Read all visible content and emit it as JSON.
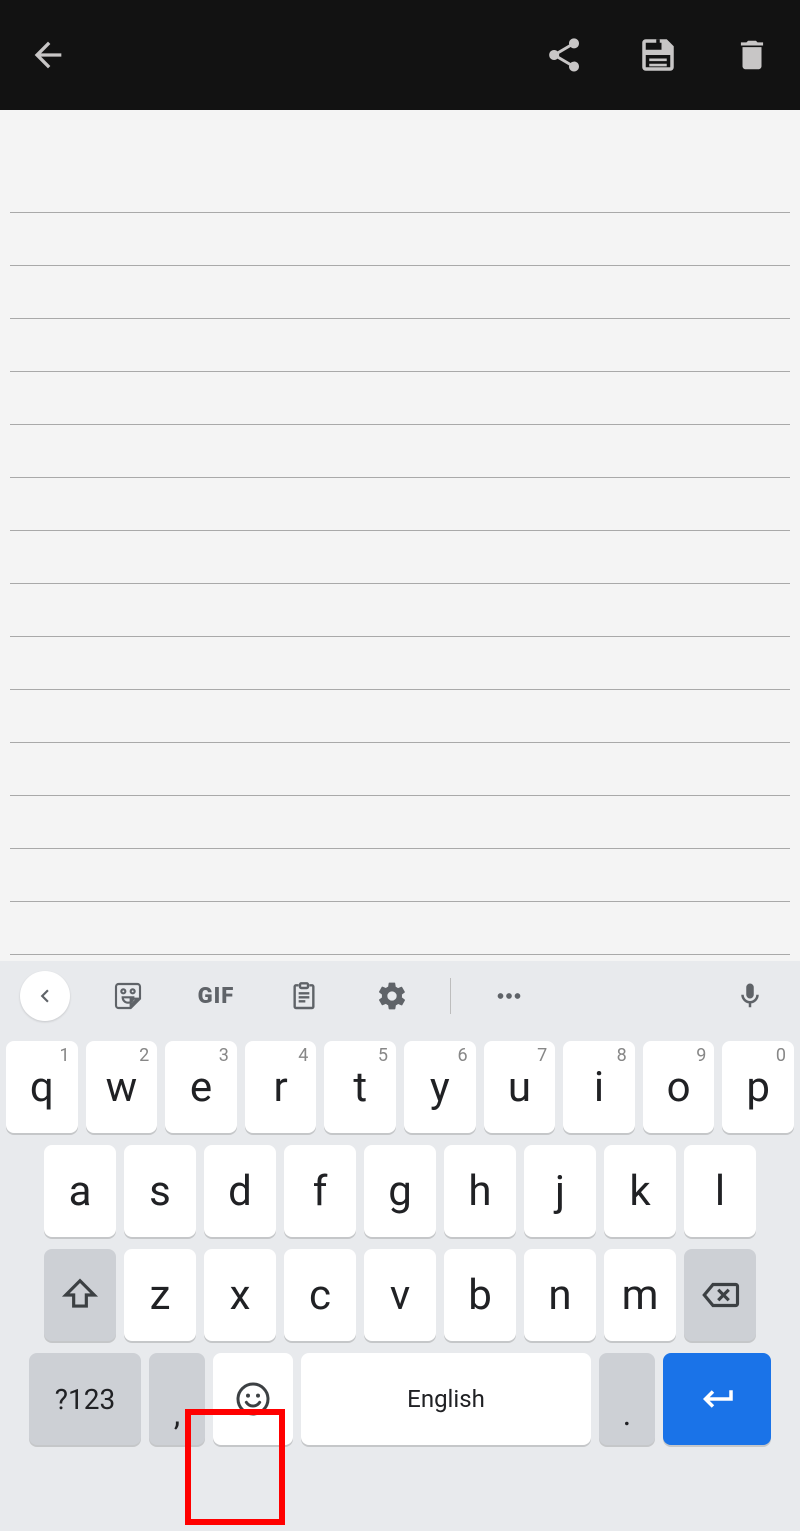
{
  "appbar": {
    "back_icon": "back-arrow-icon",
    "share_icon": "share-icon",
    "save_icon": "save-icon",
    "trash_icon": "trash-icon"
  },
  "note": {
    "line_count": 15,
    "content": ""
  },
  "keyboard": {
    "suggestion_bar": {
      "collapse_icon": "chevron-left-icon",
      "sticker_icon": "sticker-icon",
      "gif_label": "GIF",
      "clipboard_icon": "clipboard-icon",
      "settings_icon": "gear-icon",
      "more_icon": "more-horiz-icon",
      "voice_icon": "mic-icon"
    },
    "row1": [
      {
        "k": "q",
        "h": "1"
      },
      {
        "k": "w",
        "h": "2"
      },
      {
        "k": "e",
        "h": "3"
      },
      {
        "k": "r",
        "h": "4"
      },
      {
        "k": "t",
        "h": "5"
      },
      {
        "k": "y",
        "h": "6"
      },
      {
        "k": "u",
        "h": "7"
      },
      {
        "k": "i",
        "h": "8"
      },
      {
        "k": "o",
        "h": "9"
      },
      {
        "k": "p",
        "h": "0"
      }
    ],
    "row2": [
      {
        "k": "a"
      },
      {
        "k": "s"
      },
      {
        "k": "d"
      },
      {
        "k": "f"
      },
      {
        "k": "g"
      },
      {
        "k": "h"
      },
      {
        "k": "j"
      },
      {
        "k": "k"
      },
      {
        "k": "l"
      }
    ],
    "row3": [
      {
        "k": "z"
      },
      {
        "k": "x"
      },
      {
        "k": "c"
      },
      {
        "k": "v"
      },
      {
        "k": "b"
      },
      {
        "k": "n"
      },
      {
        "k": "m"
      }
    ],
    "row4": {
      "symbols_label": "?123",
      "comma_label": ",",
      "emoji_icon": "emoji-icon",
      "space_label": "English",
      "period_label": ".",
      "enter_icon": "enter-icon"
    },
    "shift_icon": "shift-icon",
    "backspace_icon": "backspace-icon",
    "highlight_target": "emoji-key"
  }
}
